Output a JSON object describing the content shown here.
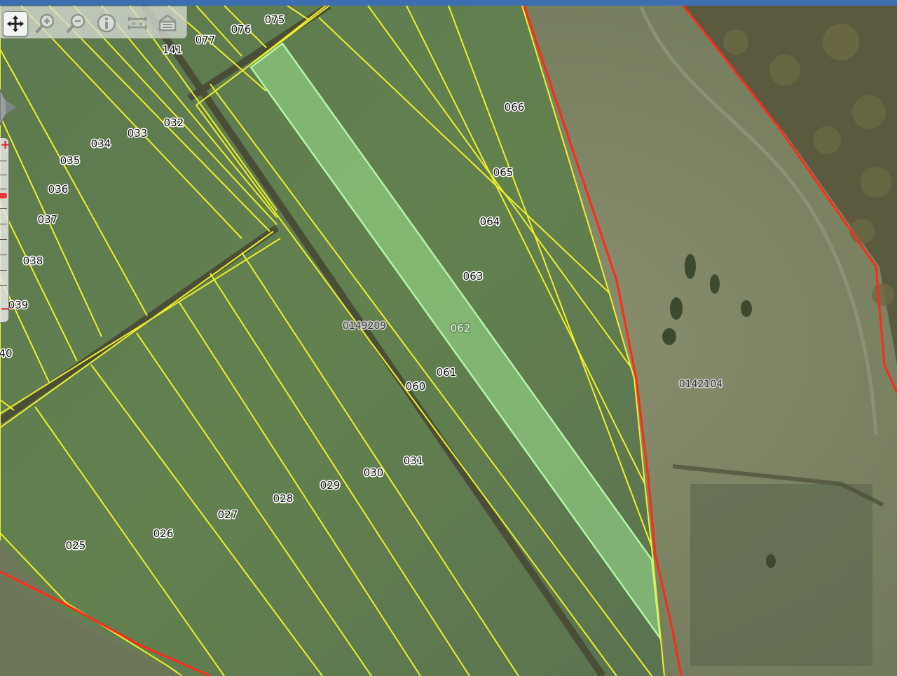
{
  "toolbar": {
    "tools": [
      {
        "name": "pan-move",
        "icon": "move-arrows-icon",
        "active": true
      },
      {
        "name": "zoom-in",
        "icon": "zoom-in-magnifier-icon"
      },
      {
        "name": "zoom-out",
        "icon": "zoom-out-magnifier-icon"
      },
      {
        "name": "info",
        "icon": "info-icon"
      },
      {
        "name": "measure",
        "icon": "measure-ruler-icon"
      },
      {
        "name": "print",
        "icon": "print-icon"
      }
    ]
  },
  "zoom": {
    "plus_label": "+",
    "minus_label": "−",
    "level_fraction": 0.33
  },
  "map": {
    "colors": {
      "field": "#5f7a52",
      "parcel_line": "#f0ee2a",
      "boundary_line": "#ff2a1a",
      "road": "#4a4e38",
      "selected_fill": "#9de38f",
      "selected_stroke": "#b5f5a8",
      "meadow": "#7a8465"
    },
    "selected_parcel": "062",
    "labels": {
      "l075": "075",
      "l076": "076",
      "l077": "077",
      "l141": "141",
      "l066": "066",
      "l065": "065",
      "l064": "064",
      "l063": "063",
      "l032": "032",
      "l033": "033",
      "l034": "034",
      "l035": "035",
      "l036": "036",
      "l037": "037",
      "l038": "038",
      "l039": "039",
      "l040": "40",
      "l062": "062",
      "l061": "061",
      "l060": "060",
      "l031": "031",
      "l030": "030",
      "l029": "029",
      "l028": "028",
      "l027": "027",
      "l026": "026",
      "l025": "025",
      "cadastral_a": "0149209",
      "cadastral_b": "0142104"
    }
  }
}
